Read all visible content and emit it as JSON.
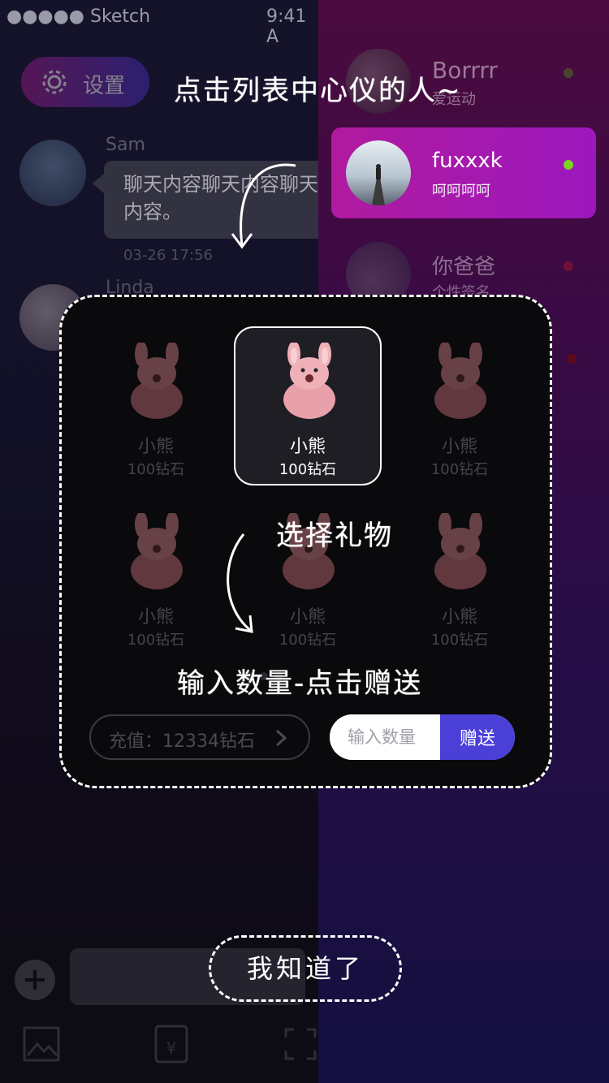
{
  "status_bar": {
    "carrier": "●●●●● Sketch",
    "time": "9:41 A"
  },
  "left_pane": {
    "settings_label": "设置",
    "messages": [
      {
        "name": "Sam",
        "text": "聊天内容聊天内容聊天内容。",
        "time": "03-26 17:56"
      },
      {
        "name": "Linda"
      }
    ]
  },
  "right_pane": {
    "contacts": [
      {
        "name": "Borrrr",
        "signature": "爱运动",
        "status_color": "#4a8a20"
      },
      {
        "name": "fuxxxk",
        "signature": "呵呵呵呵",
        "status_color": "#7ed321"
      },
      {
        "name": "你爸爸",
        "signature": "个性签名",
        "status_color": "#7a0a1a"
      }
    ]
  },
  "hints": {
    "tap_center": "点击列表中心仪的人~",
    "choose_gift": "选择礼物",
    "enter_amount": "输入数量-点击赠送"
  },
  "gift_panel": {
    "gifts": [
      {
        "name": "小熊",
        "price": "100钻石",
        "selected": false
      },
      {
        "name": "小熊",
        "price": "100钻石",
        "selected": true
      },
      {
        "name": "小熊",
        "price": "100钻石",
        "selected": false
      },
      {
        "name": "小熊",
        "price": "100钻石",
        "selected": false
      },
      {
        "name": "小熊",
        "price": "100钻石",
        "selected": false
      },
      {
        "name": "小熊",
        "price": "100钻石",
        "selected": false
      }
    ],
    "recharge_label": "充值：12334钻石",
    "quantity_placeholder": "输入数量",
    "send_label": "赠送"
  },
  "got_it_label": "我知道了",
  "colors": {
    "accent": "#4a3fd6",
    "highlight": "#b01a9e",
    "online": "#7ed321"
  }
}
